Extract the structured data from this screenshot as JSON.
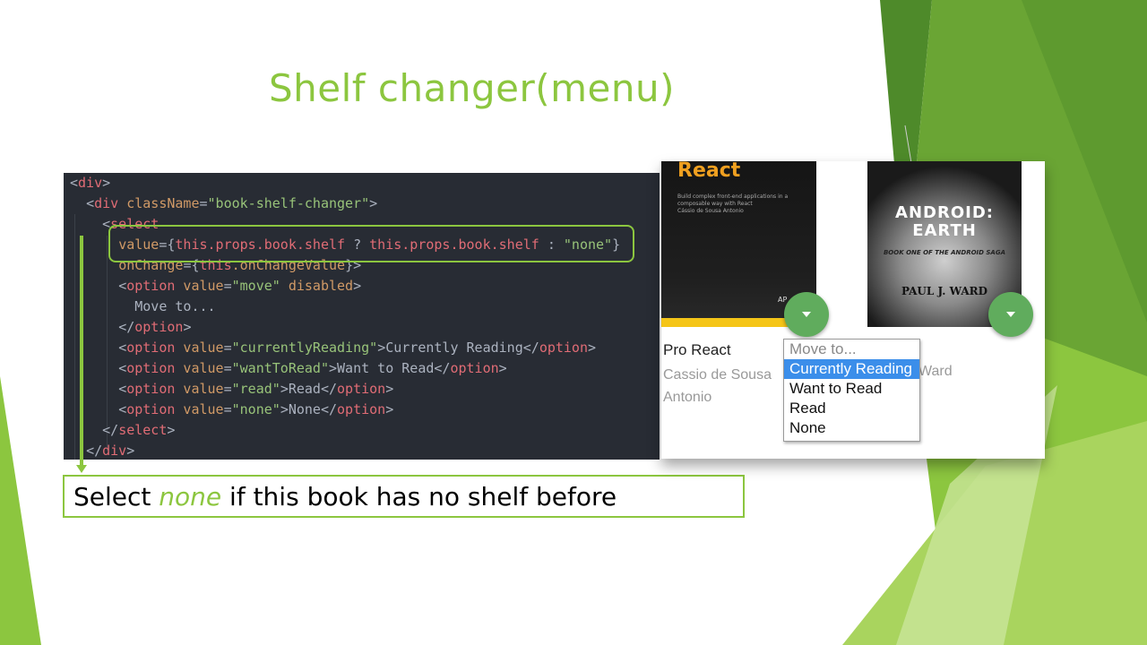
{
  "slide": {
    "title": "Shelf changer(menu)",
    "caption_prefix": "Select ",
    "caption_emph": "none",
    "caption_suffix": " if this book has no shelf before"
  },
  "code": {
    "l1_open": "<",
    "l1_tag": "div",
    "l1_close": ">",
    "l2_indent": "  ",
    "l2_open": "<",
    "l2_tag": "div",
    "l2_attr": " className",
    "l2_eq": "=",
    "l2_str": "\"book-shelf-changer\"",
    "l2_close": ">",
    "l3_indent": "    ",
    "l3_open": "<",
    "l3_tag": "select",
    "l4_indent": "      ",
    "l4_attr": "value",
    "l4_eq": "={",
    "l4_expr1": "this.props.book.shelf",
    "l4_q": " ? ",
    "l4_expr2": "this.props.book.shelf",
    "l4_colon": " : ",
    "l4_str": "\"none\"",
    "l4_end": "}",
    "l5_indent": "      ",
    "l5_attr": "onChange",
    "l5_eq": "={",
    "l5_this": "this",
    "l5_fn": ".onChangeValue",
    "l5_end": "}>",
    "l6_indent": "      ",
    "l6_open": "<",
    "l6_tag": "option",
    "l6_attr1": " value",
    "l6_eq1": "=",
    "l6_str1": "\"move\"",
    "l6_attr2": " disabled",
    "l6_close": ">",
    "l7_indent": "        ",
    "l7_text": "Move to...",
    "l8_indent": "      ",
    "l8_open": "</",
    "l8_tag": "option",
    "l8_close": ">",
    "options": [
      {
        "value": "\"currentlyReading\"",
        "label": "Currently Reading"
      },
      {
        "value": "\"wantToRead\"",
        "label": "Want to Read"
      },
      {
        "value": "\"read\"",
        "label": "Read"
      },
      {
        "value": "\"none\"",
        "label": "None"
      }
    ],
    "opt_indent": "      ",
    "opt_open": "<",
    "opt_tag": "option",
    "opt_attr": " value",
    "opt_eq": "=",
    "opt_close": ">",
    "opt_endopen": "</",
    "opt_endclose": ">",
    "l13_indent": "    ",
    "l13_open": "</",
    "l13_tag": "select",
    "l13_close": ">",
    "l14_indent": "  ",
    "l14_open": "</",
    "l14_tag": "div",
    "l14_close": ">"
  },
  "screenshot": {
    "book1": {
      "cover_title": "React",
      "cover_sub": "Build complex front-end applications in a composable way with React",
      "cover_author": "Cássio de Sousa Antonio",
      "cover_publisher": "AP",
      "title": "Pro React",
      "authors": "Cassio de Sousa Antonio"
    },
    "book2": {
      "cover_title_1": "ANDROID:",
      "cover_title_2": "EARTH",
      "cover_sub": "BOOK ONE OF THE ANDROID SAGA",
      "cover_author": "PAUL J. WARD",
      "authors_visible": "Ward"
    },
    "menu": {
      "options": [
        "Move to...",
        "Currently Reading",
        "Want to Read",
        "Read",
        "None"
      ],
      "selected_index": 1,
      "disabled_index": 0
    }
  },
  "colors": {
    "accent": "#8cc63f",
    "code_bg": "#282c34",
    "fab": "#60ac5d",
    "selection": "#3b8eea"
  }
}
